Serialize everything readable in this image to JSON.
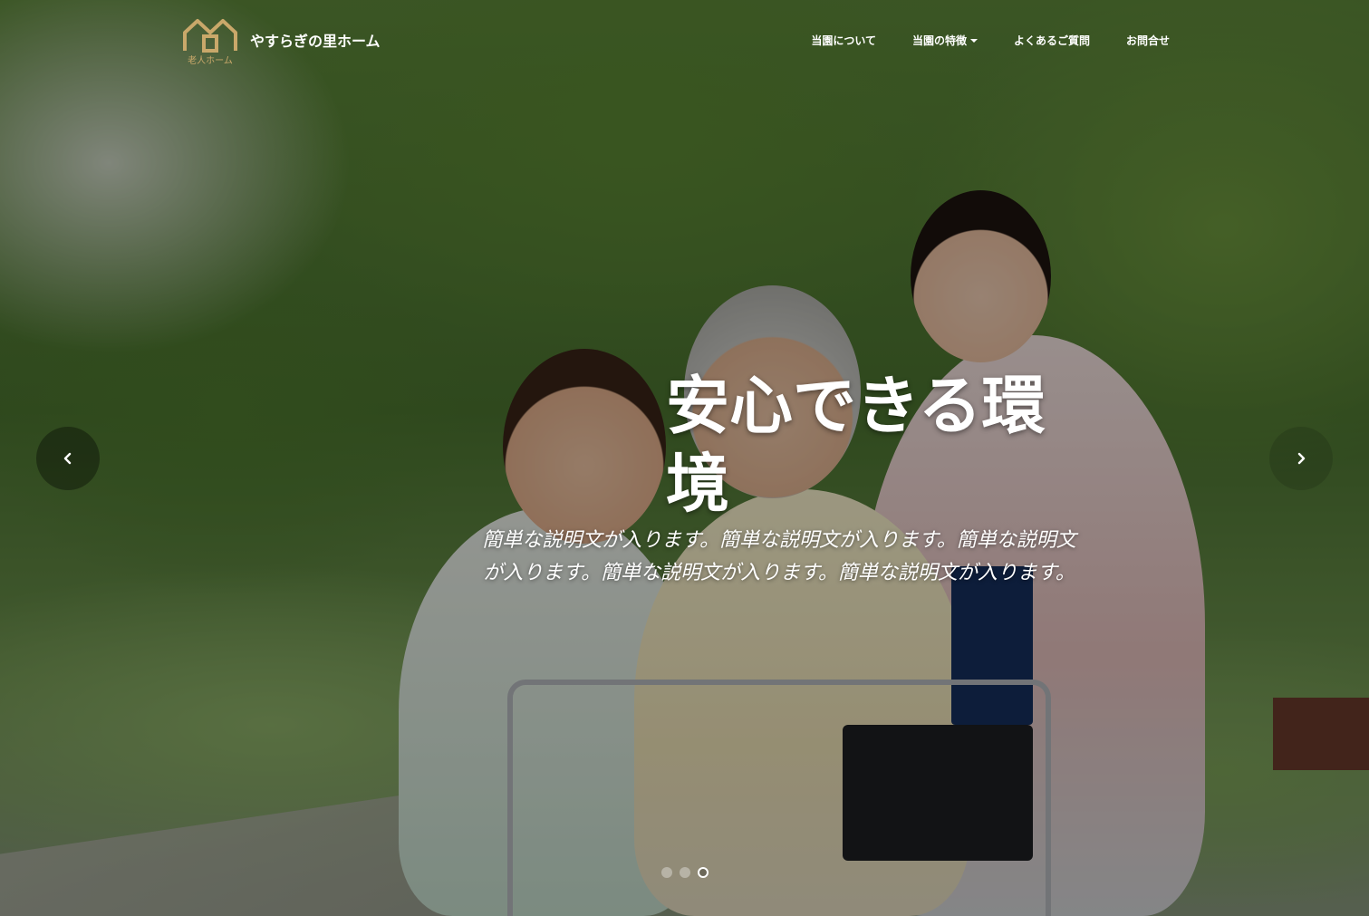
{
  "brand": {
    "logo_caption": "老人ホーム",
    "name": "やすらぎの里ホーム",
    "logo_color": "#c9a86a"
  },
  "nav": {
    "items": [
      {
        "label": "当園について",
        "has_dropdown": false
      },
      {
        "label": "当園の特徴",
        "has_dropdown": true
      },
      {
        "label": "よくあるご質問",
        "has_dropdown": false
      },
      {
        "label": "お問合せ",
        "has_dropdown": false
      }
    ]
  },
  "carousel": {
    "title": "安心できる環境",
    "text_line1": "簡単な説明文が入ります。簡単な説明文が入ります。簡単な説明文",
    "text_line2": "が入ります。簡単な説明文が入ります。簡単な説明文が入ります。",
    "slide_count": 3,
    "active_slide": 3,
    "prev_icon": "chevron-left-icon",
    "next_icon": "chevron-right-icon"
  }
}
